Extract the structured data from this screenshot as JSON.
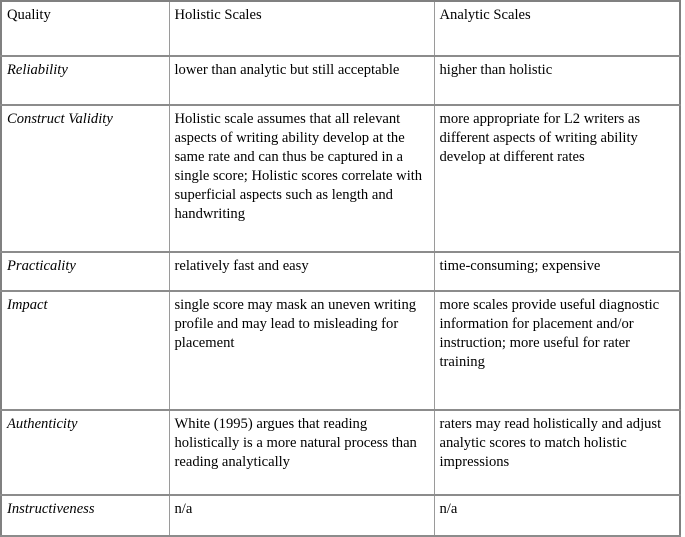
{
  "table": {
    "headers": [
      "Quality",
      "Holistic Scales",
      "Analytic Scales"
    ],
    "rows": [
      {
        "quality": "Reliability",
        "holistic": "lower than analytic but still acceptable",
        "analytic": "higher than holistic"
      },
      {
        "quality": "Construct Validity",
        "holistic": "Holistic scale assumes that all relevant aspects of writing ability develop at the same rate and can thus be captured in a single score; Holistic scores correlate with superficial aspects such as length and handwriting",
        "analytic": "more appropriate for L2 writers as different aspects of writing ability develop at different rates"
      },
      {
        "quality": "Practicality",
        "holistic": "relatively fast and easy",
        "analytic": "time-consuming; expensive"
      },
      {
        "quality": "Impact",
        "holistic": "single score may mask an uneven writing profile and may lead to misleading for placement",
        "analytic": "more scales provide useful diagnostic information for placement and/or instruction; more useful for rater training"
      },
      {
        "quality": "Authenticity",
        "holistic": "White (1995) argues that reading holistically is a more natural process than reading analytically",
        "analytic": "raters may read holistically and adjust analytic scores to match holistic impressions"
      },
      {
        "quality": "Instructiveness",
        "holistic": "n/a",
        "analytic": "n/a"
      }
    ]
  },
  "colors": {
    "text": "#000000",
    "border": "#9a9a9a",
    "outer_border": "#808080",
    "background": "#ffffff"
  }
}
